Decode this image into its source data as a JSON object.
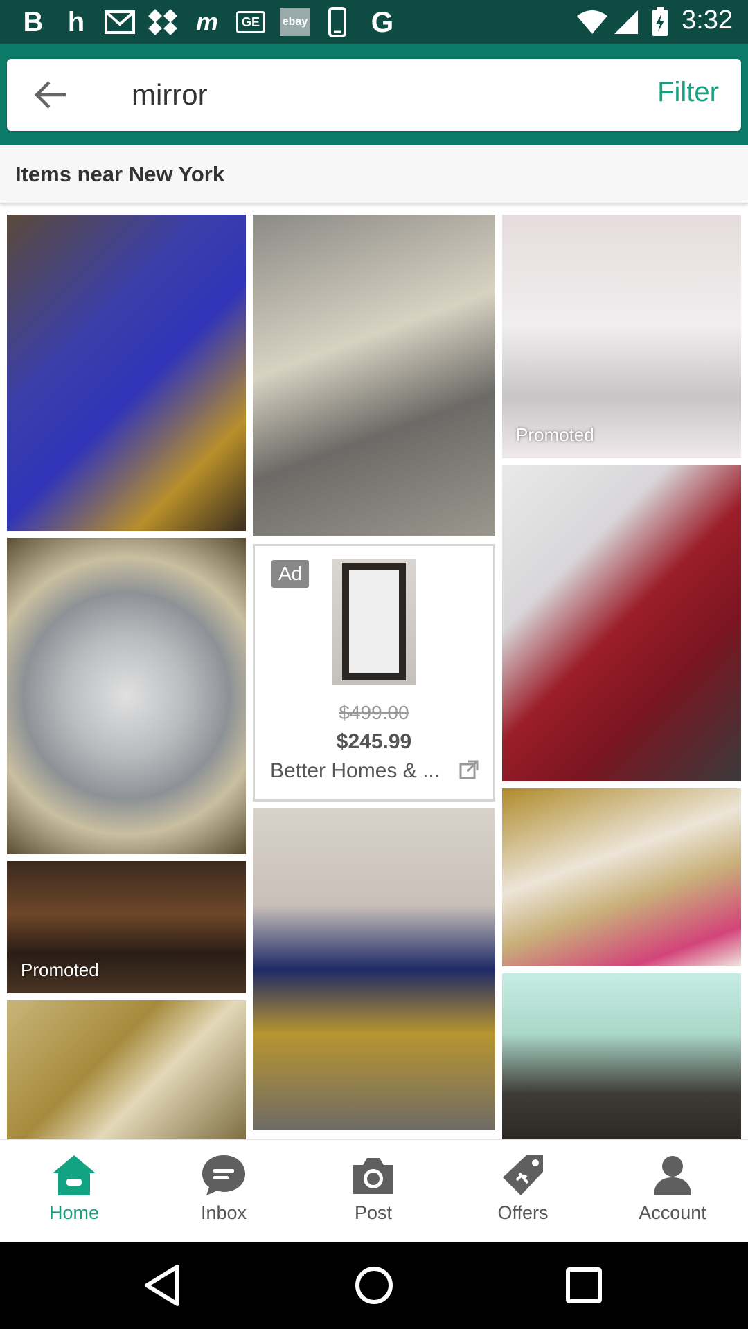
{
  "status_bar": {
    "time": "3:32",
    "icons": [
      "b-app-icon",
      "h-app-icon",
      "mail-icon",
      "dropbox-like-icon",
      "m-app-icon",
      "ge-app-icon",
      "ebay-icon",
      "phone-icon",
      "g-icon",
      "wifi-icon",
      "signal-icon",
      "battery-charging-icon"
    ],
    "ebay_label": "ebay",
    "ge_label": "GE"
  },
  "search": {
    "query": "mirror",
    "filter_label": "Filter"
  },
  "subheader": {
    "location_label": "Items near New York"
  },
  "feed": {
    "promoted_label": "Promoted",
    "ad": {
      "badge": "Ad",
      "old_price": "$499.00",
      "new_price": "$245.99",
      "store": "Better Homes & ..."
    }
  },
  "bottom_nav": {
    "items": [
      {
        "label": "Home",
        "icon": "home-icon"
      },
      {
        "label": "Inbox",
        "icon": "chat-bubble-icon"
      },
      {
        "label": "Post",
        "icon": "camera-icon"
      },
      {
        "label": "Offers",
        "icon": "price-tag-icon"
      },
      {
        "label": "Account",
        "icon": "person-icon"
      }
    ]
  },
  "colors": {
    "status_bar": "#0e4b43",
    "header": "#0d7a68",
    "accent": "#12a383"
  }
}
